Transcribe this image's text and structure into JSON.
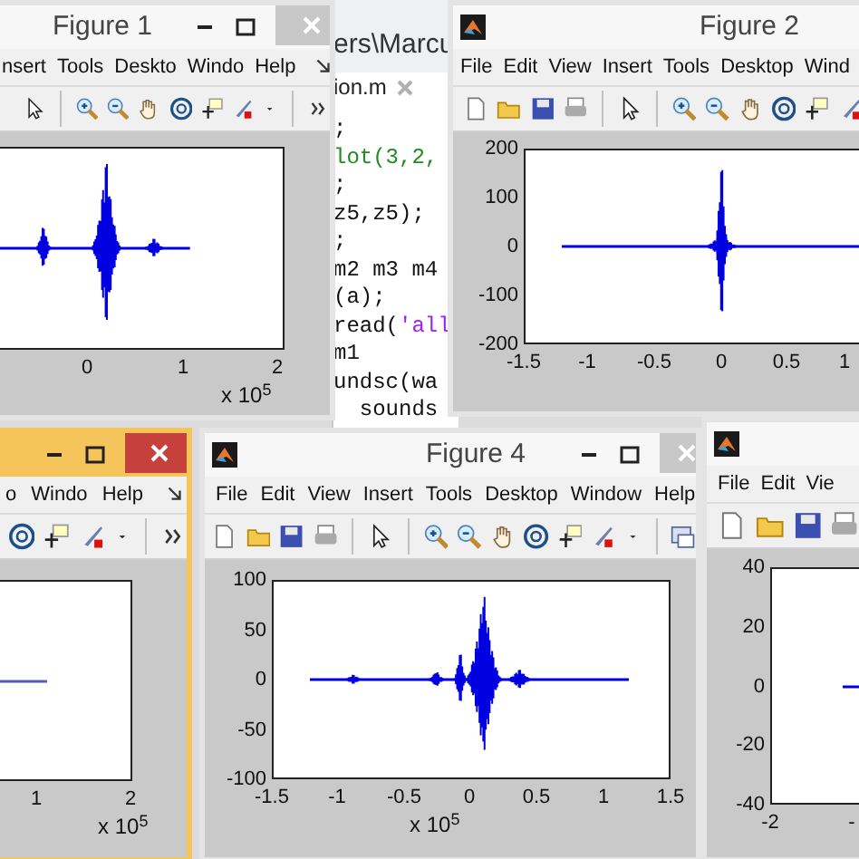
{
  "editor": {
    "path": "ers\\Marcu",
    "tab": "ion.m",
    "lines": [
      [
        {
          "kind": "code",
          "text": ";"
        }
      ],
      [
        {
          "kind": "comment",
          "text": "lot(3,2,"
        }
      ],
      [
        {
          "kind": "code",
          "text": ";"
        }
      ],
      [
        {
          "kind": "code",
          "text": "z5,z5);"
        }
      ],
      [
        {
          "kind": "code",
          "text": ";"
        }
      ],
      [
        {
          "kind": "code",
          "text": "m2 m3 m4"
        }
      ],
      [
        {
          "kind": "code",
          "text": "(a);"
        }
      ],
      [
        {
          "kind": "code",
          "text": "read("
        },
        {
          "kind": "string",
          "text": "'all"
        }
      ],
      [
        {
          "kind": "code",
          "text": "m1"
        }
      ],
      [
        {
          "kind": "code",
          "text": "undsc(wa"
        }
      ],
      [
        {
          "kind": "code",
          "text": "  sounds"
        }
      ]
    ]
  },
  "figures": [
    {
      "title": "Figure 1",
      "active": false,
      "menu": [
        "nsert",
        "Tools",
        "Deskto",
        "Windo",
        "Help"
      ],
      "axes": {
        "x_ticks": [
          "0",
          "1",
          "2"
        ],
        "x_multiplier": "x 10$^{5}$"
      }
    },
    {
      "title": "Figure 2",
      "active": false,
      "menu": [
        "File",
        "Edit",
        "View",
        "Insert",
        "Tools",
        "Desktop",
        "Wind"
      ],
      "axes": {
        "y_ticks": [
          "200",
          "100",
          "0",
          "-100",
          "-200"
        ],
        "x_ticks": [
          "-1.5",
          "-1",
          "-0.5",
          "0",
          "0.5",
          "1"
        ]
      }
    },
    {
      "active": true,
      "menu": [
        "o",
        "Windo",
        "Help"
      ],
      "axes": {
        "x_ticks": [
          "1",
          "2"
        ],
        "x_multiplier": "x 10$^{5}$"
      }
    },
    {
      "title": "Figure 4",
      "active": false,
      "menu": [
        "File",
        "Edit",
        "View",
        "Insert",
        "Tools",
        "Desktop",
        "Window",
        "Help"
      ],
      "axes": {
        "y_ticks": [
          "100",
          "50",
          "0",
          "-50",
          "-100"
        ],
        "x_ticks": [
          "-1.5",
          "-1",
          "-0.5",
          "0",
          "0.5",
          "1",
          "1.5"
        ],
        "x_multiplier": "x 10$^{5}$"
      }
    },
    {
      "active": false,
      "menu": [
        "File",
        "Edit",
        "Vie"
      ],
      "axes": {
        "y_ticks": [
          "40",
          "20",
          "0",
          "-20",
          "-40"
        ],
        "x_ticks": [
          "-2",
          "-"
        ]
      }
    }
  ]
}
